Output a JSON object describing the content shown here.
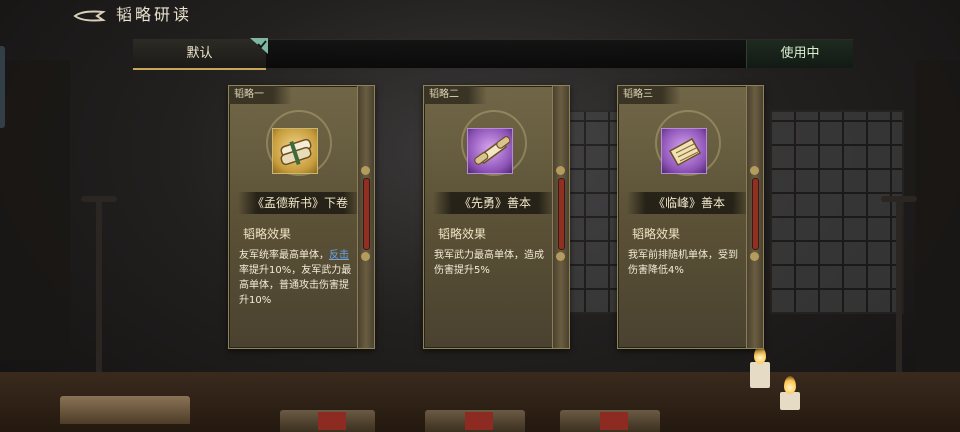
{
  "header": {
    "title": "韬略研读"
  },
  "tabs": {
    "default_label": "默认",
    "in_use_label": "使用中"
  },
  "cards": [
    {
      "tag": "韬略一",
      "name": "《孟德新书》下卷",
      "effect_title": "韬略效果",
      "effect_pre": "友军统率最高单体，",
      "effect_keyword": "反击",
      "effect_post": "率提升10%，友军武力最高单体，普通攻击伤害提升10%",
      "icon": "scroll-bundle-icon",
      "rarity_color": "#c79b3a"
    },
    {
      "tag": "韬略二",
      "name": "《先勇》善本",
      "effect_title": "韬略效果",
      "effect": "我军武力最高单体，造成伤害提升5%",
      "icon": "open-scroll-icon",
      "rarity_color": "#8c52b6"
    },
    {
      "tag": "韬略三",
      "name": "《临峰》善本",
      "effect_title": "韬略效果",
      "effect": "我军前排随机单体，受到伤害降低4%",
      "icon": "folded-scroll-icon",
      "rarity_color": "#8c52b6"
    }
  ]
}
